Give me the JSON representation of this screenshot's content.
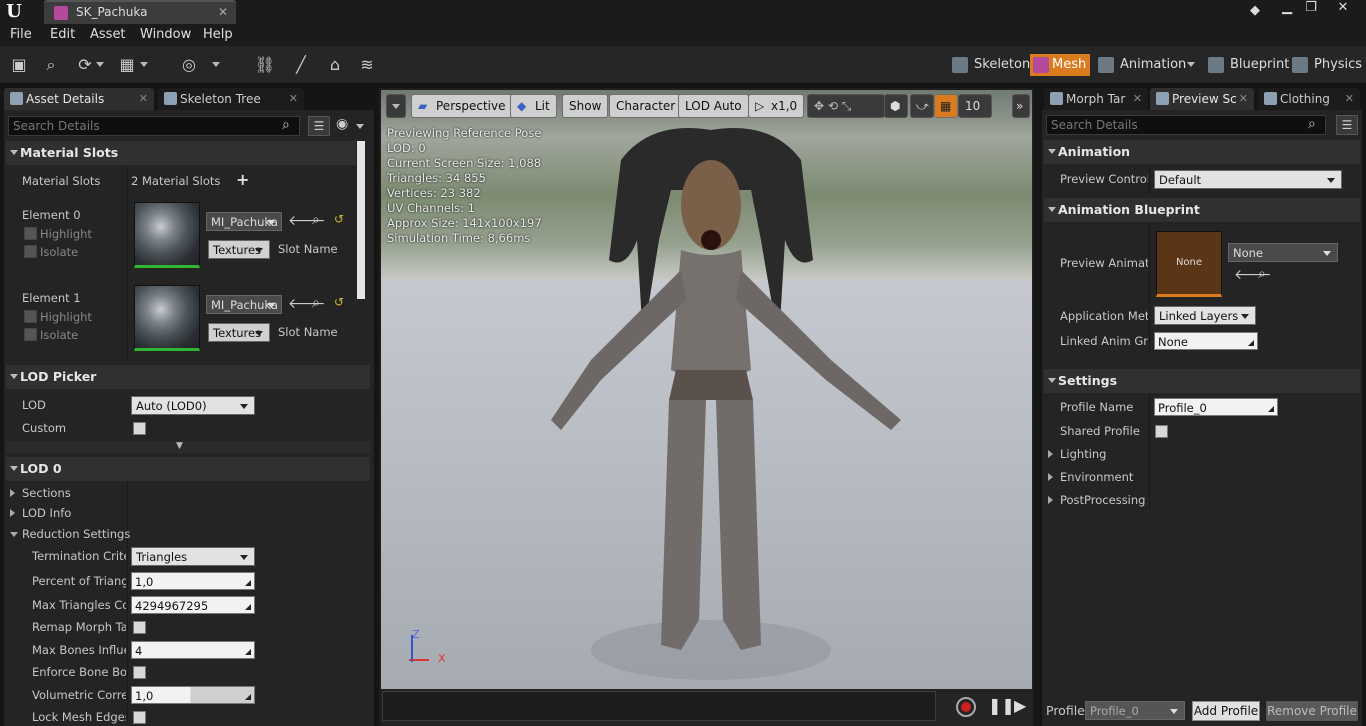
{
  "titlebar": {
    "tab_title": "SK_Pachuka"
  },
  "menu": [
    "File",
    "Edit",
    "Asset",
    "Window",
    "Help"
  ],
  "modes": [
    {
      "label": "Skeleton"
    },
    {
      "label": "Mesh"
    },
    {
      "label": "Animation"
    },
    {
      "label": "Blueprint"
    },
    {
      "label": "Physics"
    }
  ],
  "left": {
    "tabs": [
      "Asset Details",
      "Skeleton Tree"
    ],
    "search_placeholder": "Search Details",
    "material_slots": {
      "header": "Material Slots",
      "label": "Material Slots",
      "count": "2 Material Slots",
      "elements": [
        {
          "name": "Element 0",
          "highlight": "Highlight",
          "isolate": "Isolate",
          "material": "MI_Pachuka",
          "textures": "Textures",
          "slot_name": "Slot Name"
        },
        {
          "name": "Element 1",
          "highlight": "Highlight",
          "isolate": "Isolate",
          "material": "MI_Pachuka",
          "textures": "Textures",
          "slot_name": "Slot Name"
        }
      ]
    },
    "lod_picker": {
      "header": "LOD Picker",
      "lod_label": "LOD",
      "lod_value": "Auto (LOD0)",
      "custom_label": "Custom"
    },
    "lod0": {
      "header": "LOD 0",
      "sections": "Sections",
      "lod_info": "LOD Info",
      "reduction": "Reduction Settings",
      "rows": [
        {
          "label": "Termination Criter",
          "value": "Triangles"
        },
        {
          "label": "Percent of Triangle",
          "value": "1,0"
        },
        {
          "label": "Max Triangles Cou",
          "value": "4294967295"
        },
        {
          "label": "Remap Morph Targ",
          "value": ""
        },
        {
          "label": "Max Bones Influen",
          "value": "4"
        },
        {
          "label": "Enforce Bone Boun",
          "value": ""
        },
        {
          "label": "Volumetric Correct",
          "value": "1,0"
        },
        {
          "label": "Lock Mesh Edges",
          "value": ""
        }
      ]
    }
  },
  "viewport": {
    "buttons": [
      "Perspective",
      "Lit",
      "Show",
      "Character",
      "LOD Auto",
      "x1,0"
    ],
    "grid_value": "10",
    "info": [
      "Previewing Reference Pose",
      "LOD: 0",
      "Current Screen Size: 1,088",
      "Triangles: 34 855",
      "Vertices: 23 382",
      "UV Channels: 1",
      "Approx Size: 141x100x197",
      "Simulation Time: 8,66ms"
    ],
    "axis_z": "Z",
    "axis_x": "X"
  },
  "right": {
    "tabs": [
      "Morph Tar",
      "Preview Sc",
      "Clothing"
    ],
    "search_placeholder": "Search Details",
    "animation": {
      "header": "Animation",
      "preview_controller_label": "Preview Controlle",
      "preview_controller_value": "Default"
    },
    "anim_bp": {
      "header": "Animation Blueprint",
      "preview_anim_label": "Preview Animatio",
      "thumb_text": "None",
      "select_value": "None",
      "app_method_label": "Application Metho",
      "app_method_value": "Linked Layers",
      "linked_graph_label": "Linked Anim Grap",
      "linked_graph_value": "None"
    },
    "settings": {
      "header": "Settings",
      "profile_name_label": "Profile Name",
      "profile_name_value": "Profile_0",
      "shared_profile_label": "Shared Profile",
      "lighting": "Lighting",
      "environment": "Environment",
      "postprocessing": "PostProcessing"
    },
    "footer": {
      "profile_label": "Profile",
      "profile_value": "Profile_0",
      "add": "Add Profile",
      "remove": "Remove Profile"
    }
  },
  "colors": {
    "accent": "#d97b1e",
    "thumb_border": "#2fb82f"
  }
}
